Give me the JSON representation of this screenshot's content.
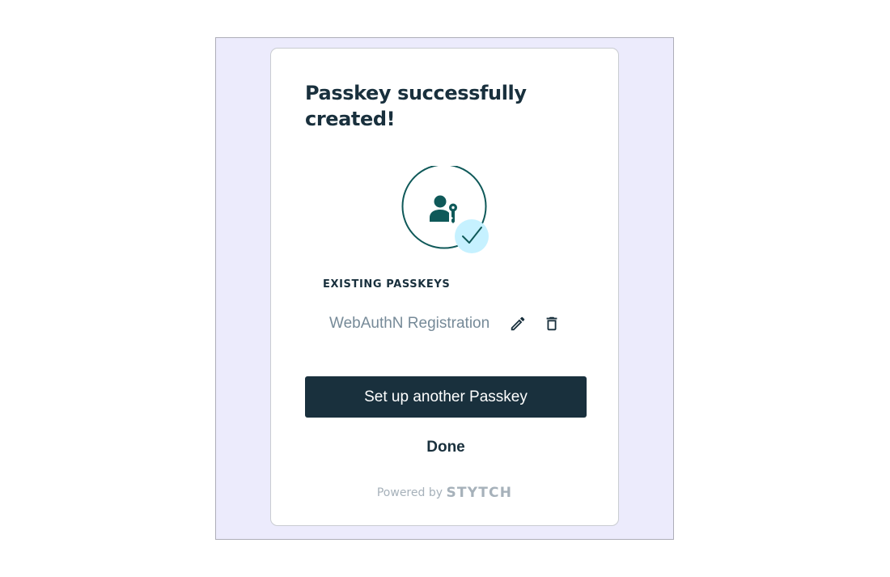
{
  "dialog": {
    "title": "Passkey successfully created!",
    "illustration_icons": [
      "user-key-icon",
      "check-icon"
    ],
    "section_label": "EXISTING PASSKEYS",
    "passkeys": [
      {
        "name": "WebAuthN Registration",
        "actions": [
          "pencil-icon",
          "trash-icon"
        ]
      }
    ],
    "primary_button": "Set up another Passkey",
    "secondary_button": "Done",
    "footer": {
      "powered_by": "Powered by",
      "brand": "STYTCH"
    }
  },
  "colors": {
    "page_background": "#ffffff",
    "frame_background": "#ecebfc",
    "card_background": "#ffffff",
    "heading": "#19303d",
    "primary_button_background": "#19303d",
    "primary_button_text": "#ffffff",
    "passkey_name": "#768a98",
    "icon_accent": "#0f5959",
    "check_badge": "#c6f1ff",
    "footer_text": "#a6b1ba"
  }
}
